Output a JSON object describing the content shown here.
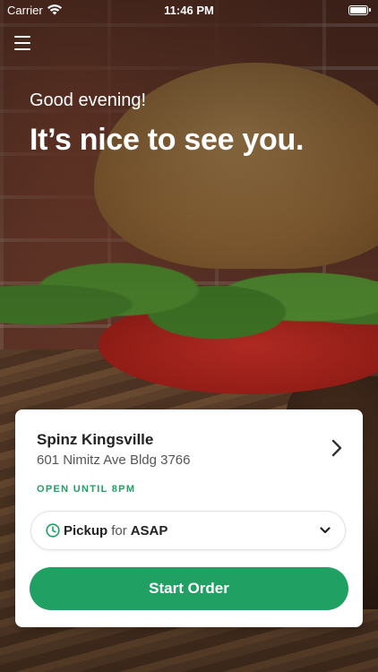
{
  "status_bar": {
    "carrier": "Carrier",
    "time": "11:46 PM"
  },
  "header": {
    "greeting": "Good evening!",
    "headline": "It’s nice to see you."
  },
  "location_card": {
    "store_name": "Spinz Kingsville",
    "address": "601 Nimitz Ave Bldg 3766",
    "open_status": "OPEN UNTIL 8PM",
    "order_mode": "Pickup",
    "for_word": "for",
    "order_time": "ASAP",
    "start_button_label": "Start Order"
  },
  "colors": {
    "accent_green": "#21a063"
  },
  "icons": {
    "menu": "hamburger-menu-icon",
    "wifi": "wifi-icon",
    "battery": "battery-icon",
    "chevron_right": "chevron-right-icon",
    "clock": "clock-icon",
    "chevron_down": "chevron-down-icon"
  }
}
